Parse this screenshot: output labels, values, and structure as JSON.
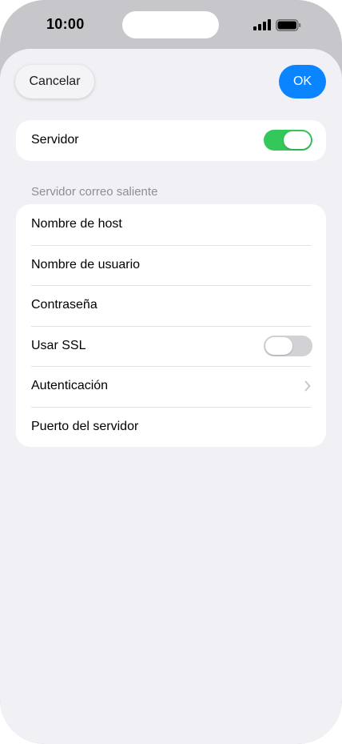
{
  "status_bar": {
    "time": "10:00",
    "icons": [
      "signal-icon",
      "battery-icon"
    ]
  },
  "header": {
    "cancel_label": "Cancelar",
    "ok_label": "OK"
  },
  "server": {
    "label": "Servidor",
    "enabled": true
  },
  "outgoing": {
    "section_title": "Servidor correo saliente",
    "rows": [
      {
        "label": "Nombre de host"
      },
      {
        "label": "Nombre de usuario"
      },
      {
        "label": "Contraseña"
      },
      {
        "label": "Usar SSL",
        "toggle": false
      },
      {
        "label": "Autenticación",
        "accessory": "chevron-right-icon"
      },
      {
        "label": "Puerto del servidor"
      }
    ]
  },
  "colors": {
    "accent": "#0a84ff",
    "toggle_on": "#34c759",
    "toggle_off": "#d1d1d6",
    "sheet_background": "#f0f0f5"
  }
}
